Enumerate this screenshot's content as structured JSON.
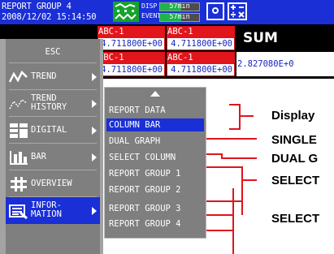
{
  "header": {
    "title": "REPORT GROUP 4",
    "datetime": "2008/12/02 15:14:50",
    "disp_label": "DISP",
    "event_label": "EVENT",
    "disp_time": "57min",
    "event_time": "57min",
    "disp_fill_fraction": 0.55,
    "event_fill_fraction": 0.55,
    "calc_glyph": "+-\n÷×"
  },
  "grid": {
    "row1": [
      {
        "tag": "ABC-1",
        "value": "4.711800E+00"
      },
      {
        "tag": "ABC-1",
        "value": "4.711800E+00"
      }
    ],
    "row2": [
      {
        "tag": "ABC-1",
        "value": "4.711800E+00"
      },
      {
        "tag": "ABC-1",
        "value": "4.711800E+00"
      }
    ],
    "sum_label": "SUM",
    "sum_value": "2.827080E+0"
  },
  "menu": {
    "esc": "ESC",
    "trend": "TREND",
    "trend_history_1": "TREND",
    "trend_history_2": "HISTORY",
    "digital": "DIGITAL",
    "bar": "BAR",
    "overview": "OVERVIEW",
    "information_1": "INFOR-",
    "information_2": "MATION"
  },
  "submenu": {
    "items": [
      "REPORT DATA",
      "COLUMN BAR",
      "DUAL GRAPH",
      "SELECT COLUMN",
      "REPORT GROUP 1",
      "REPORT GROUP 2",
      "REPORT GROUP 3",
      "REPORT GROUP 4"
    ],
    "selected_index": 1
  },
  "annotations": {
    "display": "Display",
    "single": "SINGLE",
    "dual": "DUAL G",
    "select1": "SELECT",
    "select2": "SELECT"
  },
  "colors": {
    "header_blue": "#1a2fd6",
    "alarm_red": "#e2141c",
    "value_blue": "#1426c0",
    "menu_gray": "#7f7f7f",
    "event_green": "#16a32c",
    "annotation_red": "#e0141c"
  }
}
